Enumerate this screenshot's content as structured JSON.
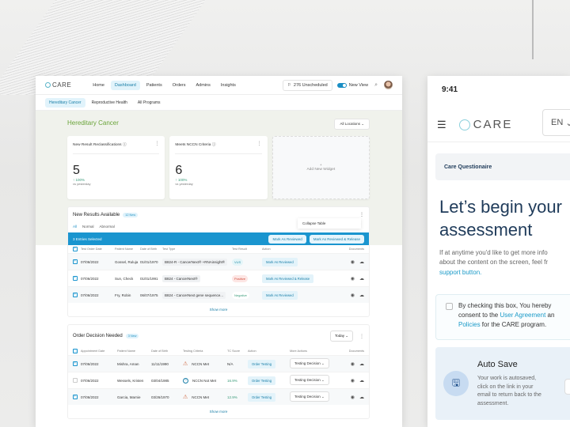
{
  "desktop": {
    "logo": "CARE",
    "nav": [
      "Home",
      "Dashboard",
      "Patients",
      "Orders",
      "Admins",
      "Insights"
    ],
    "nav_active": "Dashboard",
    "unscheduled": "276 Unscheduled",
    "new_view": "New View",
    "subnav": [
      "Hereditary Cancer",
      "Reproductive Health",
      "All Programs"
    ],
    "subnav_active": "Hereditary Cancer",
    "section_title": "Hereditary Cancer",
    "location_select": "All Locations",
    "cards": [
      {
        "title": "New Result Reclassifications",
        "value": "5",
        "change": "100%",
        "vs": "vs yesterday"
      },
      {
        "title": "Meets NCCN Criteria",
        "value": "6",
        "change": "100%",
        "vs": "vs yesterday"
      }
    ],
    "add_widget": "Add New Widget",
    "results_panel": {
      "title": "New Results Available",
      "badge": "12 New",
      "tabs": [
        "All",
        "Normal",
        "Abnormal"
      ],
      "menu_item": "Collapse Table",
      "selected_text": "3 Entries Selected",
      "bulk_buttons": [
        "Mark As Reviewed",
        "Mark As Reviewed & Release"
      ],
      "columns": [
        "Test Order Date",
        "Patient Name",
        "Date of Birth",
        "Test Type",
        "Test Result",
        "Action",
        "Documents"
      ],
      "rows": [
        {
          "date": "07/06/2022",
          "name": "Gossel, Ruluja",
          "dob": "01/01/1970",
          "type": "B824-R - CancerNext® +RNAinsight®",
          "result": "VUS",
          "result_kind": "vus",
          "action": "Mark As Reviewed"
        },
        {
          "date": "07/06/2022",
          "name": "Sun, Check",
          "dob": "01/01/1991",
          "type": "B824 - CancerNext®",
          "result": "Positive",
          "result_kind": "pos",
          "action": "Mark As Reviewed & Release"
        },
        {
          "date": "07/06/2022",
          "name": "Fry, Robin",
          "dob": "06/07/1975",
          "type": "B824 - CancerNext gene sequence...",
          "result": "Negative",
          "result_kind": "neg",
          "action": "Mark As Reviewed"
        }
      ],
      "show_more": "Show more"
    },
    "orders_panel": {
      "title": "Order Decision Needed",
      "badge": "3 New",
      "period": "Today",
      "columns": [
        "Appointment Date",
        "Patient Name",
        "Date of Birth",
        "Testing Criteria",
        "TC Score",
        "Action",
        "More Actions",
        "Documents"
      ],
      "rows": [
        {
          "date": "07/06/2022",
          "name": "Mishra, Aman",
          "dob": "11/11/1990",
          "criteria": "NCCN Met",
          "criteria_icon": "warning",
          "score": "N/A",
          "action": "Order Testing",
          "more": "Testing Decision",
          "checked": true
        },
        {
          "date": "07/06/2022",
          "name": "Wessels, Kristen",
          "dob": "03/04/1985",
          "criteria": "NCCN Not Met",
          "criteria_icon": "minus",
          "score": "16.9%",
          "action": "Order Testing",
          "more": "Testing Decision",
          "checked": false
        },
        {
          "date": "07/06/2022",
          "name": "Garcia, Marnie",
          "dob": "03/26/1970",
          "criteria": "NCCN Met",
          "criteria_icon": "warning",
          "score": "12.9%",
          "action": "Order Testing",
          "more": "Testing Decision",
          "checked": true
        }
      ],
      "show_more": "Show more"
    }
  },
  "mobile": {
    "time": "9:41",
    "logo": "CARE",
    "lang": "EN",
    "questionnaire": "Care Questionaire",
    "heading_line1": "Let’s begin your",
    "heading_line2": "assessment",
    "para_line1": "If at anytime you'd like to get more info",
    "para_line2": "about the content on the screen, feel fr",
    "para_link": "support button.",
    "consent_line1": "By checking this box, You hereby",
    "consent_pre": "consent to the ",
    "consent_link1": "User Agreement",
    "consent_post": " an",
    "consent_link2": "Policies",
    "consent_line3": " for the CARE program.",
    "autosave_title": "Auto Save",
    "autosave_text": [
      "Your work is autosaved,",
      "click on the link in your",
      "email to return back to the",
      "assessment."
    ]
  },
  "colors": {
    "accent": "#1a95cf",
    "green_title": "#6aa43a",
    "positive": "#d04b3a",
    "heading": "#1f3b5a"
  }
}
